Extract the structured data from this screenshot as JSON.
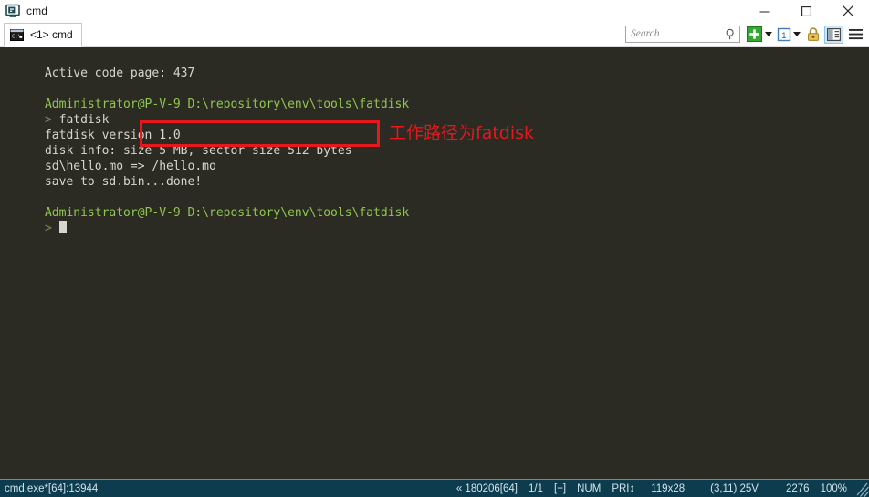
{
  "window": {
    "title": "cmd",
    "app_icon": "console-icon",
    "controls": {
      "minimize": "minimize-icon",
      "maximize": "maximize-icon",
      "close": "close-icon"
    }
  },
  "tabs": [
    {
      "label": "<1> cmd",
      "icon": "cmd-icon",
      "active": true
    }
  ],
  "toolbar": {
    "search": {
      "placeholder": "Search",
      "value": "",
      "icon": "search-icon"
    },
    "new_tab": {
      "icon": "green-plus-icon",
      "caret": "chevron-down-icon"
    },
    "panel": {
      "icon": "panel-one-icon",
      "caret": "chevron-down-icon"
    },
    "lock": {
      "icon": "lock-icon"
    },
    "split": {
      "icon": "split-panel-icon",
      "active": true
    },
    "menu": {
      "icon": "hamburger-menu-icon"
    }
  },
  "terminal": {
    "background": "#2b2b24",
    "colors": {
      "text": "#d6d6cc",
      "prompt_user": "#8fc64e",
      "prompt_chevron": "#7a8a5a"
    },
    "lines": [
      {
        "type": "text",
        "text": "Active code page: 437"
      },
      {
        "type": "blank"
      },
      {
        "type": "prompt",
        "user": "Administrator@P-V-9",
        "path": "D:\\repository\\env\\tools\\fatdisk"
      },
      {
        "type": "command",
        "chevron": ">",
        "text": " fatdisk"
      },
      {
        "type": "text",
        "text": "fatdisk version 1.0"
      },
      {
        "type": "text",
        "text": "disk info: size 5 MB, sector size 512 bytes"
      },
      {
        "type": "text",
        "text": "sd\\hello.mo => /hello.mo"
      },
      {
        "type": "text",
        "text": "save to sd.bin...done!"
      },
      {
        "type": "blank"
      },
      {
        "type": "prompt",
        "user": "Administrator@P-V-9",
        "path": "D:\\repository\\env\\tools\\fatdisk"
      },
      {
        "type": "cursor",
        "chevron": ">"
      }
    ]
  },
  "annotation": {
    "text": "工作路径为fatdisk",
    "color": "#e8171b",
    "highlight_target": "D:\\repository\\env\\tools\\fatdisk"
  },
  "statusbar": {
    "left": "cmd.exe*[64]:13944",
    "items": [
      "« 180206[64]",
      "1/1",
      "[+]",
      "NUM",
      "PRI↕",
      "119x28",
      "(3,11) 25V",
      "2276",
      "100%"
    ],
    "grip": "resize-grip-icon"
  }
}
